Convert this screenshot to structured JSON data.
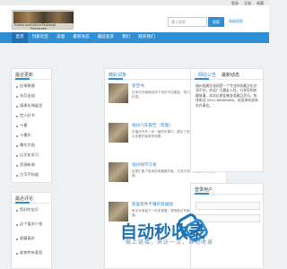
{
  "top_links": [
    "登录",
    "注册",
    "收藏"
  ],
  "logo": {
    "line1": "Pudola AntiCulture Exchange",
    "line2": "Pud.tw.com"
  },
  "search": {
    "placeholder": "输入搜索...",
    "button": "搜索",
    "advanced": "高级搜索"
  },
  "nav": [
    "首页",
    "玩家社区",
    "美图",
    "最新动态",
    "藏品鉴赏",
    "我们",
    "联系我们"
  ],
  "latest": {
    "title": "最近更新",
    "items": [
      "纪律稳健",
      "年后出战",
      "福建长城展览",
      "世人好书",
      "十墨",
      "十墨作",
      "曝光字画",
      "以文化学习",
      "资源新闻",
      "古币不知道"
    ]
  },
  "recommend": {
    "title": "精彩词条",
    "items": [
      {
        "title": "星空书",
        "desc": "在宋代中晚期流传下来的书法墨迹，笔力遒劲，为历代藏家所珍视。"
      },
      {
        "title": "福州汽车报告（有图）",
        "desc": "在福州汽车一年一度的车展中，展出了多款全新车型，吸引了众多爱好者前来观看。"
      },
      {
        "title": "福州钱币交易",
        "desc": "这里汇集了各地的收藏爱好者，交流古钱币的鉴定与收藏心得。"
      },
      {
        "title": "家里有件不懂的瓷器图",
        "desc": "家中长辈留下一件老瓷器，想请各位专家帮忙看看年代与价值。"
      }
    ]
  },
  "notice": {
    "tabs": [
      "网站公告",
      "最新动态"
    ],
    "text": "福州收藏交流网是一个专业的收藏文化交流平台，欢迎广大藏友入驻，分享您的收藏故事。本站长期征集各类藏品资讯，热线电话 0591-88888888，欢迎来电咨询合作事宜。"
  },
  "comments": {
    "title": "最近评论",
    "items": [
      "您好的宝贝",
      "这个值多少钱",
      "收藏真好",
      "老物件有意思"
    ]
  },
  "login": {
    "title": "登录用户"
  },
  "watermark": {
    "main": "自动秒收录",
    "sub": "做上链接，来访一次，自动收录"
  }
}
